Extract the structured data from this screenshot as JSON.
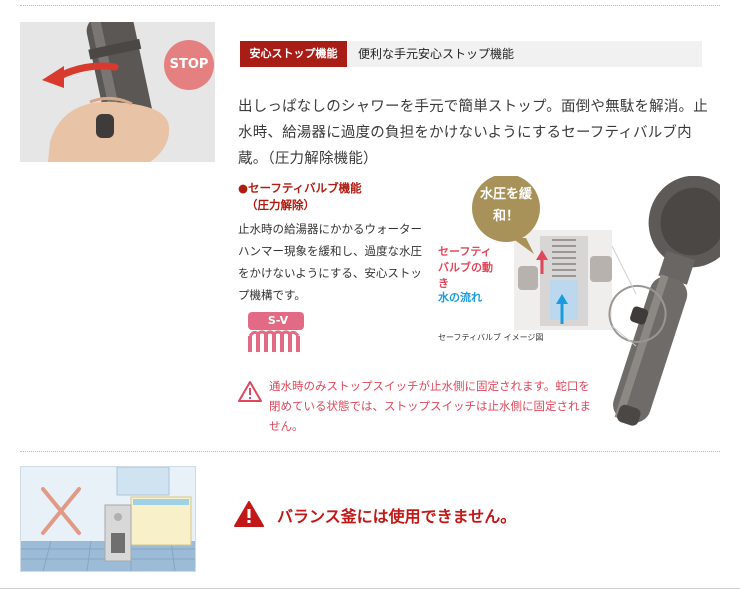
{
  "header_badge": "安心ストップ機能",
  "header_title": "便利な手元安心ストップ機能",
  "description": "出しっぱなしのシャワーを手元で簡単ストップ。面倒や無駄を解消。止水時、給湯器に過度の負担をかけないようにするセーフティバルブ内蔵。（圧力解除機能）",
  "safety_valve": {
    "heading_line1": "●セーフティバルブ機能",
    "heading_line2": "（圧力解除）",
    "body": "止水時の給湯器にかかるウォーターハンマー現象を緩和し、過度な水圧をかけないようにする、安心ストップ機構です。",
    "logo_text": "S-V"
  },
  "photo_stop_label": "STOP",
  "diagram": {
    "bubble": "水圧を緩和！",
    "valve_label": "セーフティバルブの動き",
    "flow_label": "水の流れ",
    "caption": "セーフティバルブ イメージ図"
  },
  "warning_text": "通水時のみストップスイッチが止水側に固定されます。蛇口を閉めている状態では、ストップスイッチは止水側に固定されません。",
  "caution_text": "バランス釜には使用できません。",
  "colors": {
    "badge_bg": "#a81e17",
    "accent_red": "#c21818",
    "warning_pink": "#e0475a",
    "flow_blue": "#1a9be0",
    "stop_circle": "#e58080"
  }
}
